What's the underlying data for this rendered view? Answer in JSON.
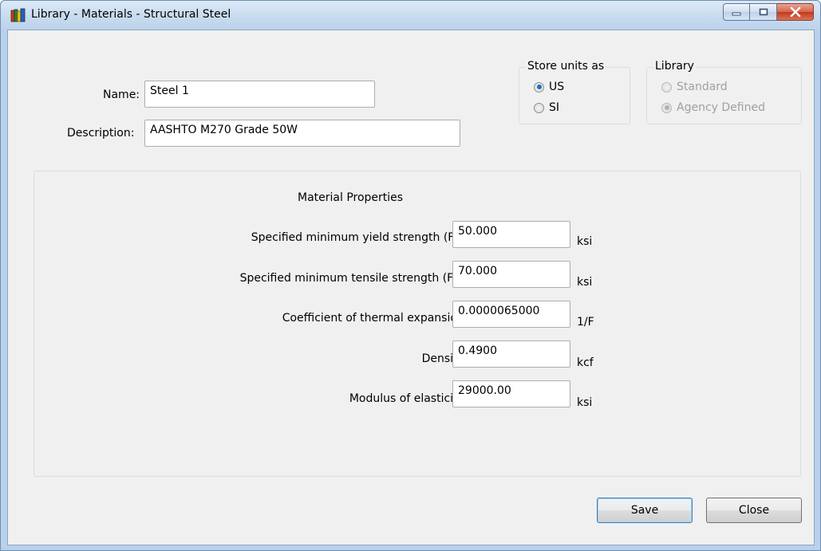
{
  "window": {
    "title": "Library - Materials - Structural Steel"
  },
  "form": {
    "name_label": "Name:",
    "name_value": "Steel 1",
    "description_label": "Description:",
    "description_value": "AASHTO M270 Grade 50W"
  },
  "store_units": {
    "title": "Store units as",
    "options": [
      "US",
      "SI"
    ],
    "selected": "US"
  },
  "library": {
    "title": "Library",
    "options": [
      "Standard",
      "Agency Defined"
    ],
    "selected": "Agency Defined",
    "enabled": false
  },
  "material_properties": {
    "title": "Material Properties",
    "rows": [
      {
        "label": "Specified minimum yield strength (Fy) =",
        "value": "50.000",
        "unit": "ksi"
      },
      {
        "label": "Specified minimum tensile strength (Fu) =",
        "value": "70.000",
        "unit": "ksi"
      },
      {
        "label": "Coefficient of thermal expansion =",
        "value": "0.0000065000",
        "unit": "1/F"
      },
      {
        "label": "Density =",
        "value": "0.4900",
        "unit": "kcf"
      },
      {
        "label": "Modulus of elasticity =",
        "value": "29000.00",
        "unit": "ksi"
      }
    ]
  },
  "buttons": {
    "save": "Save",
    "close": "Close"
  },
  "icons": {
    "app": "books-icon",
    "minimize": "minimize-icon",
    "maximize": "maximize-icon",
    "close": "close-icon"
  },
  "colors": {
    "title_bar": "#c8dbef",
    "client_bg": "#f0f0f0",
    "close_button": "#c6381c",
    "radio_selected": "#1f6fc2"
  }
}
